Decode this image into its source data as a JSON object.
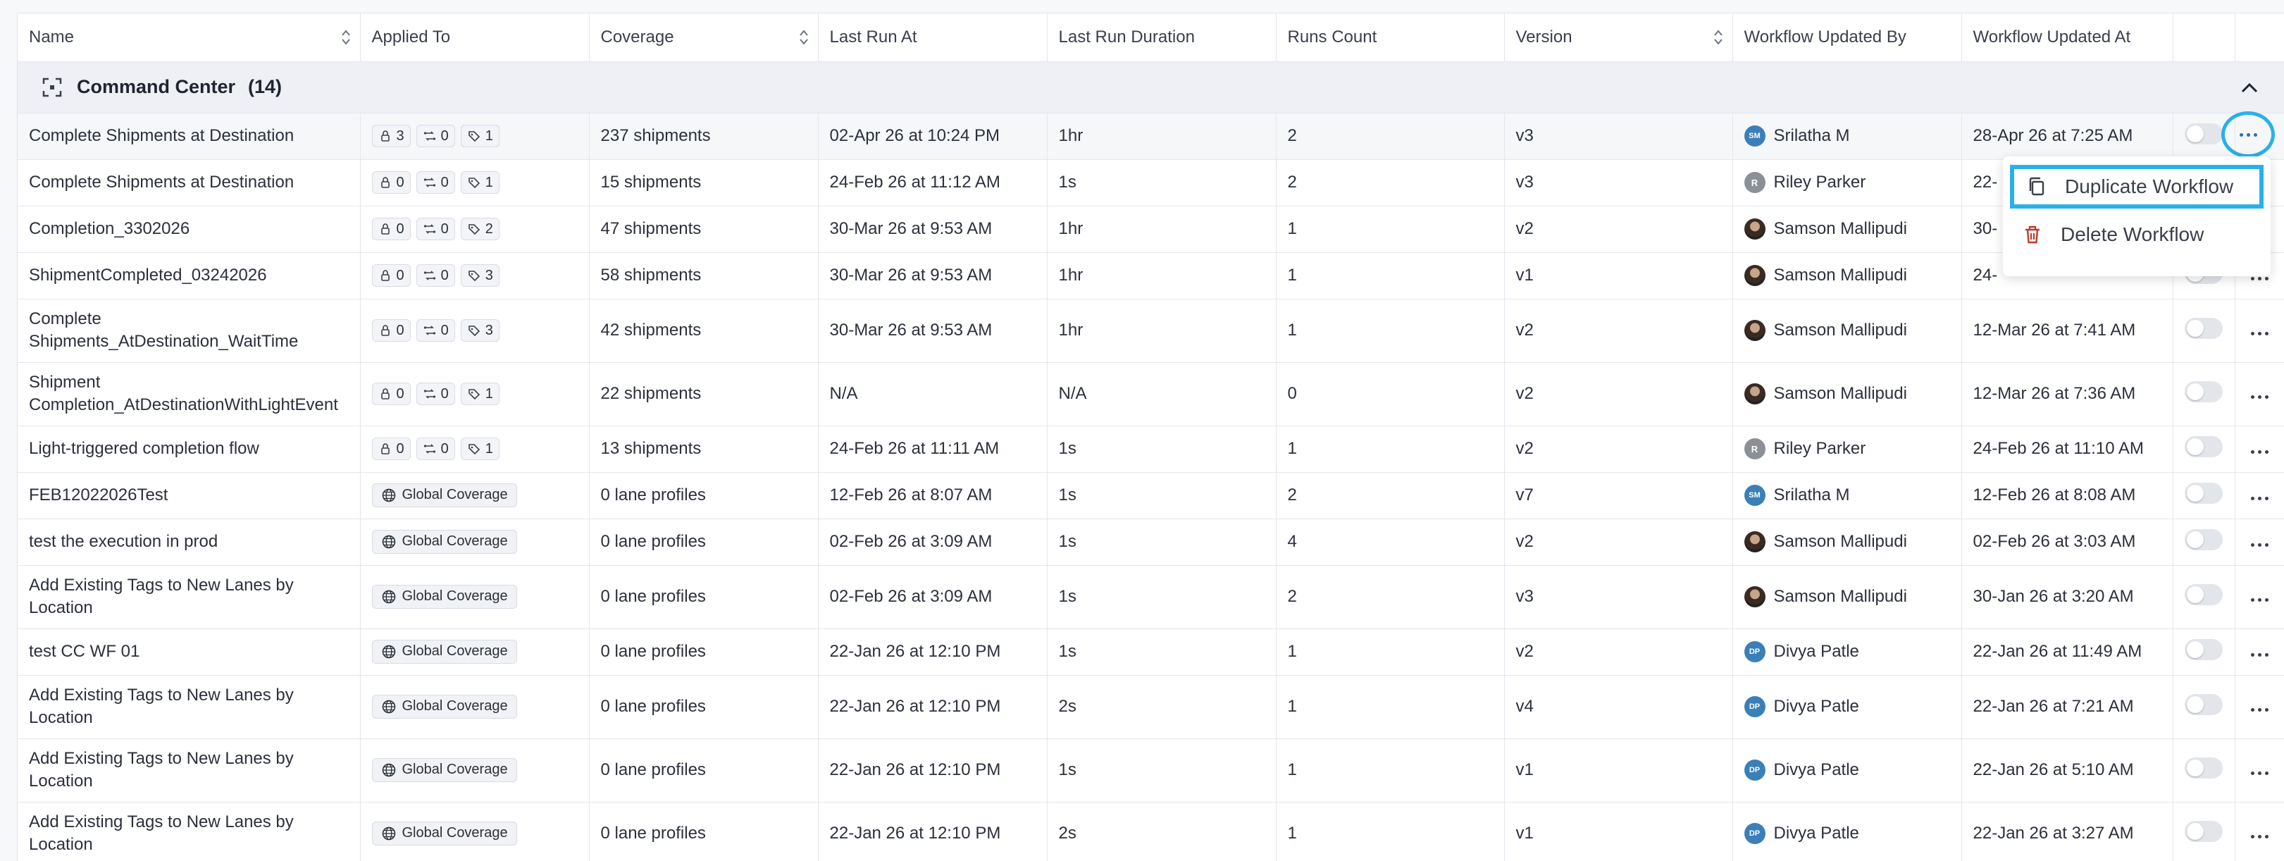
{
  "columns": [
    {
      "label": "Name",
      "sortable": true
    },
    {
      "label": "Applied To",
      "sortable": false
    },
    {
      "label": "Coverage",
      "sortable": true
    },
    {
      "label": "Last Run At",
      "sortable": false
    },
    {
      "label": "Last Run Duration",
      "sortable": false
    },
    {
      "label": "Runs Count",
      "sortable": false
    },
    {
      "label": "Version",
      "sortable": true
    },
    {
      "label": "Workflow Updated By",
      "sortable": false
    },
    {
      "label": "Workflow Updated At",
      "sortable": false
    },
    {
      "label": "",
      "sortable": false
    },
    {
      "label": "",
      "sortable": false
    }
  ],
  "group": {
    "name": "Command Center",
    "count": "(14)"
  },
  "rows": [
    {
      "name": "Complete Shipments at Destination",
      "applied": {
        "type": "counts",
        "a": "3",
        "b": "0",
        "c": "1"
      },
      "coverage": "237 shipments",
      "last_run": "02-Apr 26 at 10:24 PM",
      "duration": "1hr",
      "runs": "2",
      "version": "v3",
      "user": {
        "name": "Srilatha M",
        "initials": "SM",
        "avatar": "blue"
      },
      "updated_at": "28-Apr 26 at 7:25 AM"
    },
    {
      "name": "Complete Shipments at Destination",
      "applied": {
        "type": "counts",
        "a": "0",
        "b": "0",
        "c": "1"
      },
      "coverage": "15 shipments",
      "last_run": "24-Feb 26 at 11:12 AM",
      "duration": "1s",
      "runs": "2",
      "version": "v3",
      "user": {
        "name": "Riley Parker",
        "initials": "R",
        "avatar": "gray"
      },
      "updated_at": "22-"
    },
    {
      "name": "Completion_3302026",
      "applied": {
        "type": "counts",
        "a": "0",
        "b": "0",
        "c": "2"
      },
      "coverage": "47 shipments",
      "last_run": "30-Mar 26 at 9:53 AM",
      "duration": "1hr",
      "runs": "1",
      "version": "v2",
      "user": {
        "name": "Samson Mallipudi",
        "initials": "",
        "avatar": "photo"
      },
      "updated_at": "30-"
    },
    {
      "name": "ShipmentCompleted_03242026",
      "applied": {
        "type": "counts",
        "a": "0",
        "b": "0",
        "c": "3"
      },
      "coverage": "58 shipments",
      "last_run": "30-Mar 26 at 9:53 AM",
      "duration": "1hr",
      "runs": "1",
      "version": "v1",
      "user": {
        "name": "Samson Mallipudi",
        "initials": "",
        "avatar": "photo"
      },
      "updated_at": "24-"
    },
    {
      "name": "Complete Shipments_AtDestination_WaitTime",
      "applied": {
        "type": "counts",
        "a": "0",
        "b": "0",
        "c": "3"
      },
      "coverage": "42 shipments",
      "last_run": "30-Mar 26 at 9:53 AM",
      "duration": "1hr",
      "runs": "1",
      "version": "v2",
      "user": {
        "name": "Samson Mallipudi",
        "initials": "",
        "avatar": "photo"
      },
      "updated_at": "12-Mar 26 at 7:41 AM"
    },
    {
      "name": "Shipment Completion_AtDestinationWithLightEvent",
      "applied": {
        "type": "counts",
        "a": "0",
        "b": "0",
        "c": "1"
      },
      "coverage": "22 shipments",
      "last_run": "N/A",
      "duration": "N/A",
      "runs": "0",
      "version": "v2",
      "user": {
        "name": "Samson Mallipudi",
        "initials": "",
        "avatar": "photo"
      },
      "updated_at": "12-Mar 26 at 7:36 AM"
    },
    {
      "name": "Light-triggered completion flow",
      "applied": {
        "type": "counts",
        "a": "0",
        "b": "0",
        "c": "1"
      },
      "coverage": "13 shipments",
      "last_run": "24-Feb 26 at 11:11 AM",
      "duration": "1s",
      "runs": "1",
      "version": "v2",
      "user": {
        "name": "Riley Parker",
        "initials": "R",
        "avatar": "gray"
      },
      "updated_at": "24-Feb 26 at 11:10 AM"
    },
    {
      "name": "FEB12022026Test",
      "applied": {
        "type": "global",
        "label": "Global Coverage"
      },
      "coverage": "0 lane profiles",
      "last_run": "12-Feb 26 at 8:07 AM",
      "duration": "1s",
      "runs": "2",
      "version": "v7",
      "user": {
        "name": "Srilatha M",
        "initials": "SM",
        "avatar": "blue"
      },
      "updated_at": "12-Feb 26 at 8:08 AM"
    },
    {
      "name": "test the execution in prod",
      "applied": {
        "type": "global",
        "label": "Global Coverage"
      },
      "coverage": "0 lane profiles",
      "last_run": "02-Feb 26 at 3:09 AM",
      "duration": "1s",
      "runs": "4",
      "version": "v2",
      "user": {
        "name": "Samson Mallipudi",
        "initials": "",
        "avatar": "photo"
      },
      "updated_at": "02-Feb 26 at 3:03 AM"
    },
    {
      "name": "Add Existing Tags to New Lanes by Location",
      "applied": {
        "type": "global",
        "label": "Global Coverage"
      },
      "coverage": "0 lane profiles",
      "last_run": "02-Feb 26 at 3:09 AM",
      "duration": "1s",
      "runs": "2",
      "version": "v3",
      "user": {
        "name": "Samson Mallipudi",
        "initials": "",
        "avatar": "photo"
      },
      "updated_at": "30-Jan 26 at 3:20 AM"
    },
    {
      "name": "test CC WF 01",
      "applied": {
        "type": "global",
        "label": "Global Coverage"
      },
      "coverage": "0 lane profiles",
      "last_run": "22-Jan 26 at 12:10 PM",
      "duration": "1s",
      "runs": "1",
      "version": "v2",
      "user": {
        "name": "Divya Patle",
        "initials": "DP",
        "avatar": "blue"
      },
      "updated_at": "22-Jan 26 at 11:49 AM"
    },
    {
      "name": "Add Existing Tags to New Lanes by Location",
      "applied": {
        "type": "global",
        "label": "Global Coverage"
      },
      "coverage": "0 lane profiles",
      "last_run": "22-Jan 26 at 12:10 PM",
      "duration": "2s",
      "runs": "1",
      "version": "v4",
      "user": {
        "name": "Divya Patle",
        "initials": "DP",
        "avatar": "blue"
      },
      "updated_at": "22-Jan 26 at 7:21 AM"
    },
    {
      "name": "Add Existing Tags to New Lanes by Location",
      "applied": {
        "type": "global",
        "label": "Global Coverage"
      },
      "coverage": "0 lane profiles",
      "last_run": "22-Jan 26 at 12:10 PM",
      "duration": "1s",
      "runs": "1",
      "version": "v1",
      "user": {
        "name": "Divya Patle",
        "initials": "DP",
        "avatar": "blue"
      },
      "updated_at": "22-Jan 26 at 5:10 AM"
    },
    {
      "name": "Add Existing Tags to New Lanes by Location",
      "applied": {
        "type": "global",
        "label": "Global Coverage"
      },
      "coverage": "0 lane profiles",
      "last_run": "22-Jan 26 at 12:10 PM",
      "duration": "2s",
      "runs": "1",
      "version": "v1",
      "user": {
        "name": "Divya Patle",
        "initials": "DP",
        "avatar": "blue"
      },
      "updated_at": "22-Jan 26 at 3:27 AM"
    }
  ],
  "menu": {
    "items": [
      {
        "label": "Duplicate Workflow",
        "icon": "copy-icon",
        "highlighted": true
      },
      {
        "label": "Delete Workflow",
        "icon": "trash-icon",
        "highlighted": false
      }
    ]
  },
  "colors": {
    "accent": "#2ab0e8",
    "danger": "#c0392b",
    "avatar_blue": "#3b7fb8"
  }
}
